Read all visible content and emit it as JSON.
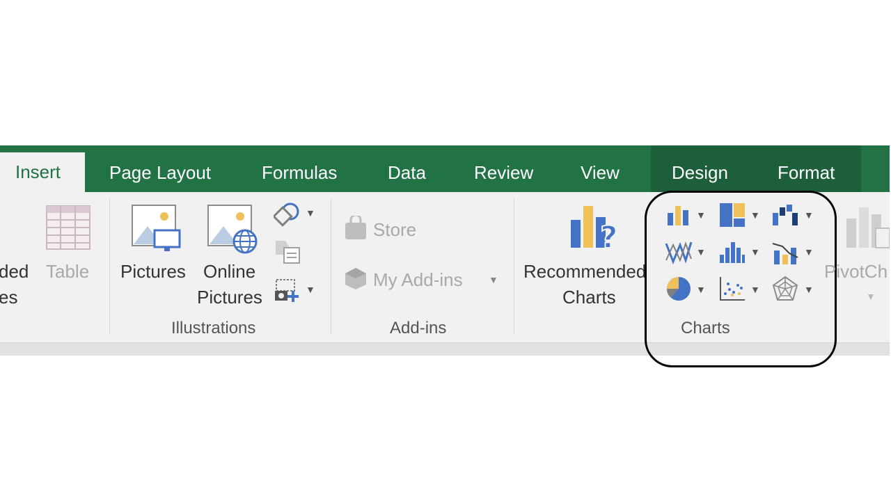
{
  "tabs": {
    "insert": "Insert",
    "page_layout": "Page Layout",
    "formulas": "Formulas",
    "data": "Data",
    "review": "Review",
    "view": "View",
    "design": "Design",
    "format": "Format"
  },
  "tables_group": {
    "recommended_label_partial_1": "ded",
    "recommended_label_partial_2": "es",
    "table_label": "Table"
  },
  "illustrations": {
    "pictures": "Pictures",
    "online_line1": "Online",
    "online_line2": "Pictures",
    "group_label": "Illustrations"
  },
  "addins": {
    "store": "Store",
    "my_addins": "My Add-ins",
    "group_label": "Add-ins"
  },
  "charts": {
    "recommended_line1": "Recommended",
    "recommended_line2": "Charts",
    "group_label": "Charts",
    "pivot_partial": "PivotCh"
  },
  "colors": {
    "excel_green": "#217346",
    "context_green": "#1d5f3a",
    "ribbon_bg": "#f1f1f1",
    "chart_blue": "#4472c4",
    "chart_gold": "#f0c05a"
  },
  "icons": [
    "table-icon",
    "pictures-icon",
    "online-pictures-icon",
    "shapes-icon",
    "smartart-icon",
    "screenshot-icon",
    "store-icon",
    "my-addins-icon",
    "recommended-charts-icon",
    "column-chart-icon",
    "hierarchy-chart-icon",
    "waterfall-chart-icon",
    "line-chart-icon",
    "statistic-chart-icon",
    "combo-chart-icon",
    "pie-chart-icon",
    "scatter-chart-icon",
    "radar-chart-icon",
    "pivotchart-icon"
  ]
}
